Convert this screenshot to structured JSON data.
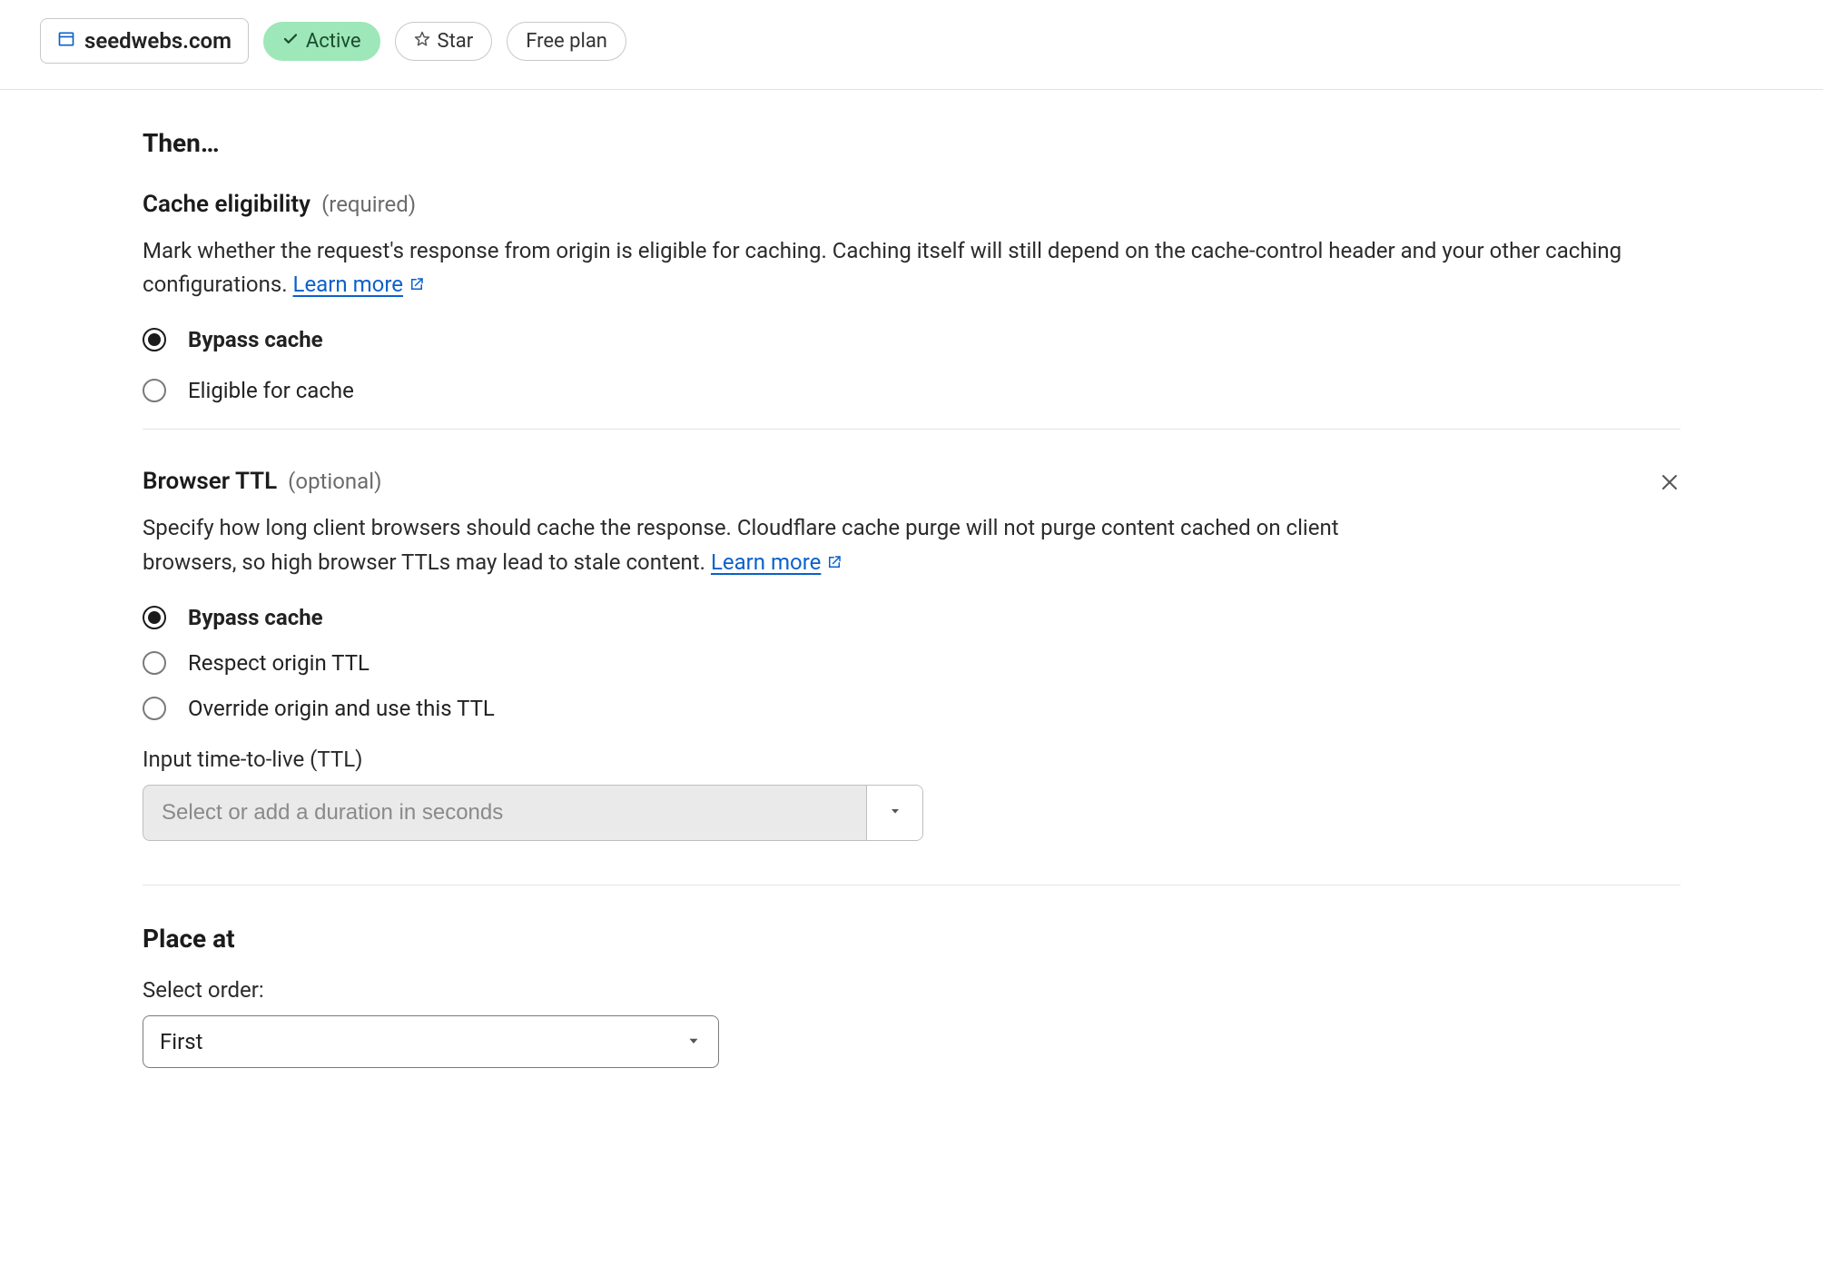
{
  "header": {
    "domain": "seedwebs.com",
    "status_label": "Active",
    "star_label": "Star",
    "plan_label": "Free plan"
  },
  "then_heading": "Then…",
  "cache": {
    "title": "Cache eligibility",
    "req": "(required)",
    "desc_prefix": "Mark whether the request's response from origin is eligible for caching. Caching itself will still depend on the cache-control header and your other caching configurations. ",
    "learn": "Learn more",
    "opt_bypass": "Bypass cache",
    "opt_eligible": "Eligible for cache"
  },
  "browser": {
    "title": "Browser TTL",
    "req": "(optional)",
    "desc_prefix": "Specify how long client browsers should cache the response. Cloudflare cache purge will not purge content cached on client browsers, so high browser TTLs may lead to stale content. ",
    "learn": "Learn more",
    "opt_bypass": "Bypass cache",
    "opt_respect": "Respect origin TTL",
    "opt_override": "Override origin and use this TTL",
    "ttl_label": "Input time-to-live (TTL)",
    "ttl_placeholder": "Select or add a duration in seconds"
  },
  "place": {
    "title": "Place at",
    "order_label": "Select order:",
    "order_value": "First"
  }
}
